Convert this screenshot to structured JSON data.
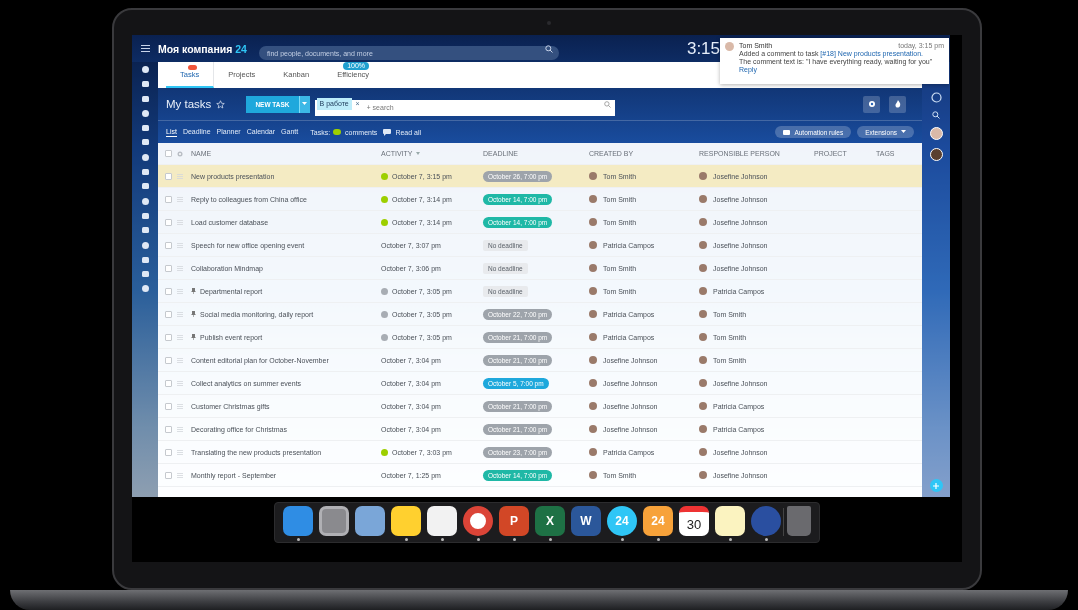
{
  "header": {
    "company": "Моя компания",
    "company_suffix": "24",
    "search": {
      "placeholder": "find people, documents, and more"
    },
    "time": "3:15"
  },
  "tabs": [
    {
      "label": "Tasks",
      "selected": true,
      "alert": true
    },
    {
      "label": "Projects",
      "selected": false
    },
    {
      "label": "Kanban",
      "selected": false
    },
    {
      "label": "Efficiency",
      "selected": false,
      "badge": "100%"
    }
  ],
  "notification": {
    "author": "Tom Smith",
    "time": "today, 3:15 pm",
    "text": "Added a comment to task",
    "link": "[#18] New products presentation.",
    "comment": "The comment text is: \"I have everything ready, waiting for you\"",
    "reply": "Reply"
  },
  "toolbar": {
    "title": "My tasks",
    "new_task": "NEW TASK",
    "filter_chip": "В работе",
    "filter_chip_remove": "×",
    "search": {
      "placeholder": "+ search"
    }
  },
  "views": [
    {
      "label": "List",
      "selected": true
    },
    {
      "label": "Deadline",
      "selected": false
    },
    {
      "label": "Planner",
      "selected": false
    },
    {
      "label": "Calendar",
      "selected": false
    },
    {
      "label": "Gantt",
      "selected": false
    }
  ],
  "counters": {
    "label": "Tasks:",
    "comments": "comments",
    "read_all": "Read all"
  },
  "actions": {
    "automation": "Automation rules",
    "extensions": "Extensions"
  },
  "table": {
    "all_checked": false,
    "columns": [
      "NAME",
      "ACTIVITY",
      "DEADLINE",
      "CREATED BY",
      "RESPONSIBLE PERSON",
      "PROJECT",
      "TAGS"
    ],
    "rows": [
      {
        "name": "New products presentation",
        "selected": true,
        "checked": false,
        "pinned": false,
        "comment_badge": {
          "color": "#9dcf00"
        },
        "activity": "October 7, 3:15 pm",
        "deadline": {
          "text": "October 26, 7:00 pm",
          "color": "#9ea4ab"
        },
        "created_by": "Tom Smith",
        "responsible": "Josefine Johnson"
      },
      {
        "name": "Reply to colleagues from China office",
        "selected": false,
        "checked": false,
        "pinned": false,
        "comment_badge": {
          "color": "#9dcf00"
        },
        "activity": "October 7, 3:14 pm",
        "deadline": {
          "text": "October 14, 7:00 pm",
          "color": "#1fb8a6"
        },
        "created_by": "Tom Smith",
        "responsible": "Josefine Johnson"
      },
      {
        "name": "Load customer database",
        "selected": false,
        "checked": false,
        "pinned": false,
        "comment_badge": {
          "color": "#9dcf00"
        },
        "activity": "October 7, 3:14 pm",
        "deadline": {
          "text": "October 14, 7:00 pm",
          "color": "#1fb8a6"
        },
        "created_by": "Tom Smith",
        "responsible": "Josefine Johnson"
      },
      {
        "name": "Speech for new office opening event",
        "selected": false,
        "checked": false,
        "pinned": false,
        "activity": "October 7, 3:07 pm",
        "deadline": {
          "text": "No deadline"
        },
        "created_by": "Patricia Campos",
        "responsible": "Josefine Johnson"
      },
      {
        "name": "Collaboration Mindmap",
        "selected": false,
        "checked": false,
        "pinned": false,
        "activity": "October 7, 3:06 pm",
        "deadline": {
          "text": "No deadline"
        },
        "created_by": "Tom Smith",
        "responsible": "Josefine Johnson"
      },
      {
        "name": "Departmental report",
        "selected": false,
        "checked": false,
        "pinned": true,
        "comment_badge": {
          "color": "#a8adb4"
        },
        "activity": "October 7, 3:05 pm",
        "deadline": {
          "text": "No deadline"
        },
        "created_by": "Tom Smith",
        "responsible": "Patricia Campos"
      },
      {
        "name": "Social media monitoring, daily report",
        "selected": false,
        "checked": false,
        "pinned": true,
        "comment_badge": {
          "color": "#a8adb4"
        },
        "activity": "October 7, 3:05 pm",
        "deadline": {
          "text": "October 22, 7:00 pm",
          "color": "#9ea4ab"
        },
        "created_by": "Patricia Campos",
        "responsible": "Tom Smith"
      },
      {
        "name": "Publish event report",
        "selected": false,
        "checked": false,
        "pinned": true,
        "comment_badge": {
          "color": "#a8adb4"
        },
        "activity": "October 7, 3:05 pm",
        "deadline": {
          "text": "October 21, 7:00 pm",
          "color": "#9ea4ab"
        },
        "created_by": "Patricia Campos",
        "responsible": "Tom Smith"
      },
      {
        "name": "Content editorial plan for October-November",
        "selected": false,
        "checked": false,
        "pinned": false,
        "activity": "October 7, 3:04 pm",
        "deadline": {
          "text": "October 21, 7:00 pm",
          "color": "#9ea4ab"
        },
        "created_by": "Josefine Johnson",
        "responsible": "Tom Smith"
      },
      {
        "name": "Collect analytics on summer events",
        "selected": false,
        "checked": false,
        "pinned": false,
        "activity": "October 7, 3:04 pm",
        "deadline": {
          "text": "October 5, 7:00 pm",
          "color": "#1ea8dc"
        },
        "created_by": "Josefine Johnson",
        "responsible": "Josefine Johnson"
      },
      {
        "name": "Customer Christmas gifts",
        "selected": false,
        "checked": false,
        "pinned": false,
        "activity": "October 7, 3:04 pm",
        "deadline": {
          "text": "October 21, 7:00 pm",
          "color": "#9ea4ab"
        },
        "created_by": "Josefine Johnson",
        "responsible": "Patricia Campos"
      },
      {
        "name": "Decorating office for Christmas",
        "selected": false,
        "checked": false,
        "pinned": false,
        "activity": "October 7, 3:04 pm",
        "deadline": {
          "text": "October 21, 7:00 pm",
          "color": "#9ea4ab"
        },
        "created_by": "Josefine Johnson",
        "responsible": "Patricia Campos"
      },
      {
        "name": "Translating the new products presentation",
        "selected": false,
        "checked": false,
        "pinned": false,
        "comment_badge": {
          "color": "#9dcf00"
        },
        "activity": "October 7, 3:03 pm",
        "deadline": {
          "text": "October 23, 7:00 pm",
          "color": "#9ea4ab"
        },
        "created_by": "Patricia Campos",
        "responsible": "Josefine Johnson"
      },
      {
        "name": "Monthly report - September",
        "selected": false,
        "checked": false,
        "pinned": false,
        "activity": "October 7, 1:25 pm",
        "deadline": {
          "text": "October 14, 7:00 pm",
          "color": "#1fb8a6"
        },
        "created_by": "Tom Smith",
        "responsible": "Josefine Johnson"
      }
    ]
  },
  "dock": [
    {
      "kind": "finder",
      "running": true
    },
    {
      "kind": "settings",
      "running": false
    },
    {
      "kind": "preview",
      "running": false
    },
    {
      "kind": "miro",
      "running": true
    },
    {
      "kind": "textedit",
      "running": true
    },
    {
      "kind": "chrome",
      "running": true
    },
    {
      "kind": "powerpoint",
      "running": true,
      "label": "P"
    },
    {
      "kind": "excel",
      "running": true,
      "label": "X"
    },
    {
      "kind": "word",
      "running": false,
      "label": "W"
    },
    {
      "kind": "cloud",
      "running": true,
      "label": "24"
    },
    {
      "kind": "chat",
      "running": true,
      "label": "24"
    },
    {
      "kind": "calendar",
      "running": false,
      "label": "30"
    },
    {
      "kind": "notes",
      "running": true
    },
    {
      "kind": "bolt",
      "running": true
    },
    {
      "kind": "trash",
      "running": false
    }
  ]
}
